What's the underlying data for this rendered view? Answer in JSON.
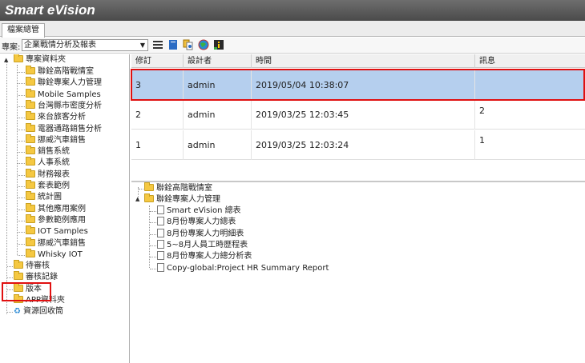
{
  "app": {
    "title": "Smart eVision"
  },
  "tabs": [
    {
      "label": "檔案總管"
    }
  ],
  "toolbar": {
    "project_label": "專案:",
    "project_value": "企業戰情分析及報表",
    "icons": [
      "list-icon",
      "book-icon",
      "docs-settings-icon",
      "globe-icon",
      "info-icon"
    ]
  },
  "tree": {
    "root": "專案資料夾",
    "children": [
      "聯銓高階戰情室",
      "聯銓專案人力管理",
      "Mobile Samples",
      "台灣縣市密度分析",
      "來台旅客分析",
      "電器通路銷售分析",
      "挪威汽車銷售",
      "銷售系統",
      "人事系統",
      "財務報表",
      "套表範例",
      "統計圖",
      "其他應用案例",
      "參數範例應用",
      "IOT Samples",
      "挪威汽車銷售",
      "Whisky IOT"
    ],
    "pending": "待審核",
    "audit": "審核記錄",
    "version": "版本",
    "app_folder": "APP資料夾",
    "recycle": "資源回收筒"
  },
  "grid": {
    "columns": [
      "修訂",
      "設計者",
      "時間",
      "訊息"
    ],
    "rows": [
      {
        "rev": "3",
        "designer": "admin",
        "time": "2019/05/04 10:38:07",
        "msg": ""
      },
      {
        "rev": "2",
        "designer": "admin",
        "time": "2019/03/25 12:03:45",
        "msg": "2"
      },
      {
        "rev": "1",
        "designer": "admin",
        "time": "2019/03/25 12:03:24",
        "msg": "1"
      }
    ]
  },
  "detail": {
    "folders": [
      "聯銓高階戰情室",
      "聯銓專案人力管理"
    ],
    "docs": [
      "Smart eVision 總表",
      "8月份專案人力總表",
      "8月份專案人力明細表",
      "5~8月人員工時歷程表",
      "8月份專案人力總分析表",
      "Copy-global:Project HR Summary Report"
    ]
  },
  "colors": {
    "selection": "#b5cfee",
    "highlight": "#e01010",
    "titlebar": "#555555"
  }
}
